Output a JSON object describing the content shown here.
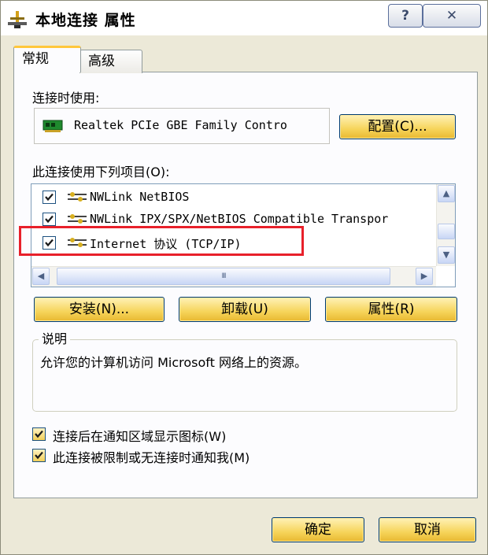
{
  "window": {
    "title": "本地连接 属性",
    "help_label": "?",
    "close_label": "✕"
  },
  "tabs": [
    {
      "label": "常规",
      "active": true
    },
    {
      "label": "高级",
      "active": false
    }
  ],
  "general": {
    "connect_using_label": "连接时使用:",
    "adapter_name": "Realtek PCIe GBE Family Contro",
    "configure_button": "配置(C)...",
    "items_label": "此连接使用下列项目(O):",
    "items": [
      {
        "label": "NWLink NetBIOS",
        "checked": true
      },
      {
        "label": "NWLink IPX/SPX/NetBIOS Compatible Transpor",
        "checked": true
      },
      {
        "label": "Internet 协议 (TCP/IP)",
        "checked": true
      }
    ],
    "install_button": "安装(N)...",
    "uninstall_button": "卸载(U)",
    "properties_button": "属性(R)",
    "description_title": "说明",
    "description_text": "允许您的计算机访问 Microsoft 网络上的资源。",
    "show_icon_checkbox": {
      "label": "连接后在通知区域显示图标(W)",
      "checked": true
    },
    "notify_checkbox": {
      "label": "此连接被限制或无连接时通知我(M)",
      "checked": true
    }
  },
  "footer": {
    "ok_button": "确定",
    "cancel_button": "取消"
  },
  "scrollbar": {
    "up_arrow": "▲",
    "down_arrow": "▼",
    "left_arrow": "◀",
    "right_arrow": "▶",
    "thumb_grip": "III"
  },
  "colors": {
    "highlight_box": "#e8202a",
    "button_gradient_top": "#fff2b8",
    "button_gradient_bottom": "#e8b830",
    "window_bg": "#ece9d8"
  }
}
